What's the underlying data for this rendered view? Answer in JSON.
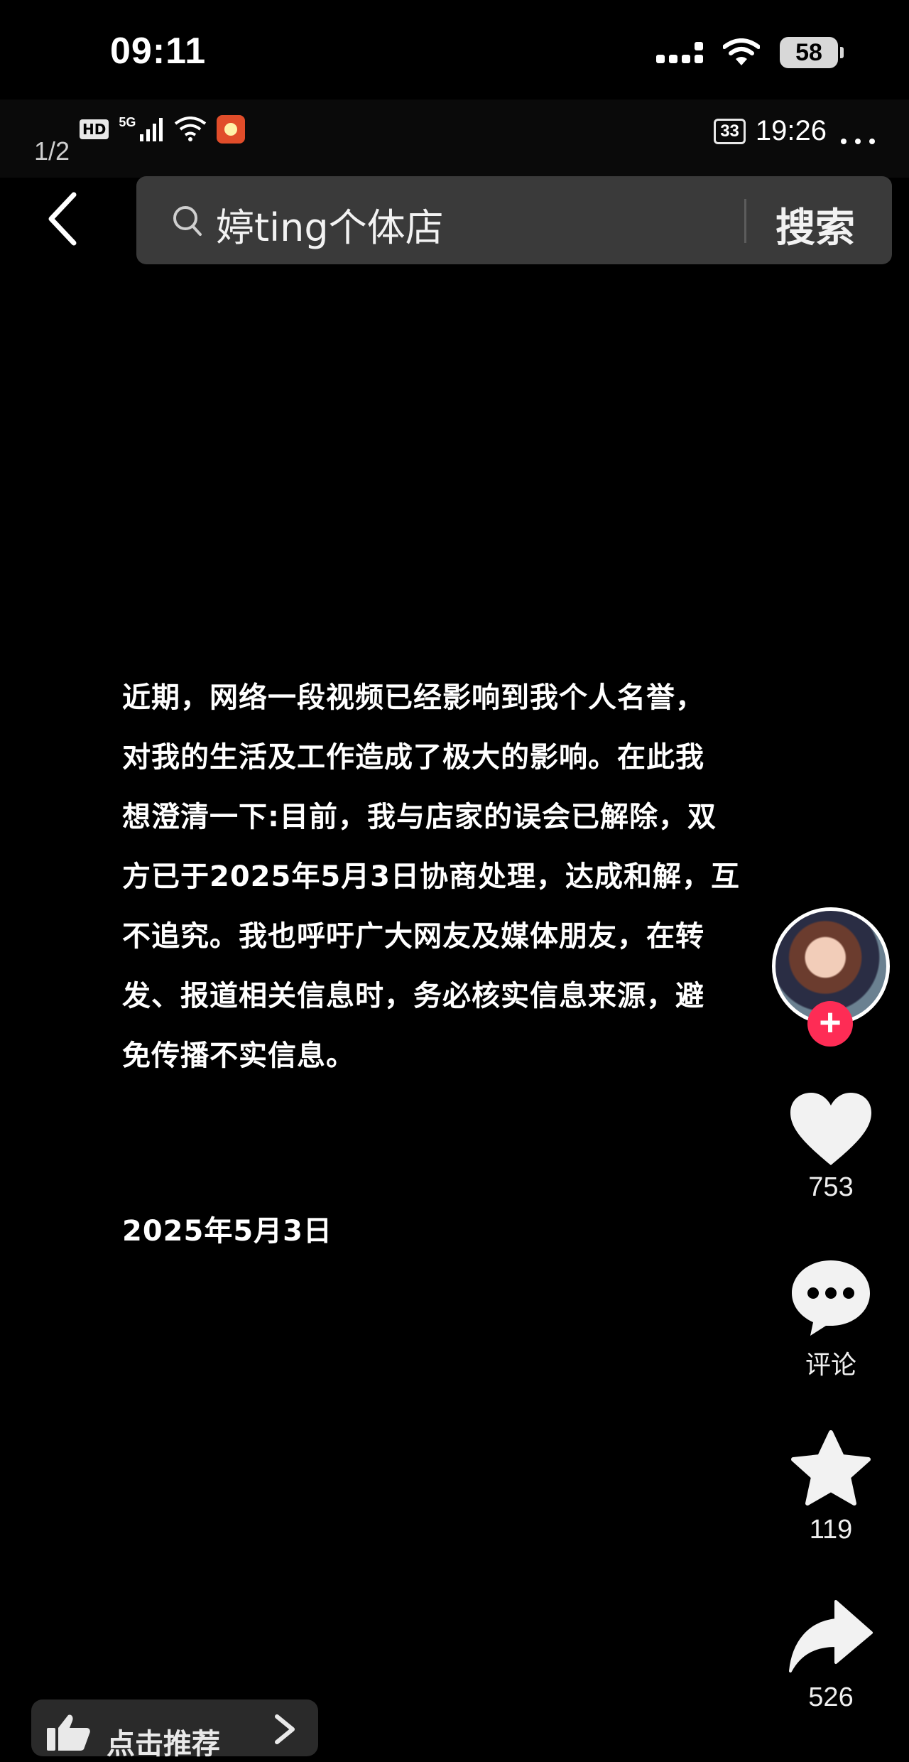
{
  "outer_status": {
    "time": "09:11",
    "battery": "58"
  },
  "inner_status": {
    "page_indicator": "1/2",
    "hd_badge": "HD",
    "network": "5G",
    "battery": "33",
    "time": "19:26"
  },
  "search": {
    "query": "婷ting个体店",
    "button_label": "搜索"
  },
  "statement": {
    "text": "近期，网络一段视频已经影响到我个人名誉，\n对我的生活及工作造成了极大的影响。在此我\n想澄清一下:目前，我与店家的误会已解除，双\n方已于2025年5月3日协商处理，达成和解，互\n不追究。我也呼吁广大网友及媒体朋友，在转\n发、报道相关信息时，务必核实信息来源，避\n免传播不实信息。",
    "date": "2025年5月3日"
  },
  "actions": {
    "likes": "753",
    "comment_label": "评论",
    "favorites": "119",
    "shares": "526"
  },
  "recommend": {
    "label": "点击推荐"
  },
  "colors": {
    "follow_accent": "#fe2c55",
    "search_bg": "#3a3a3a"
  }
}
